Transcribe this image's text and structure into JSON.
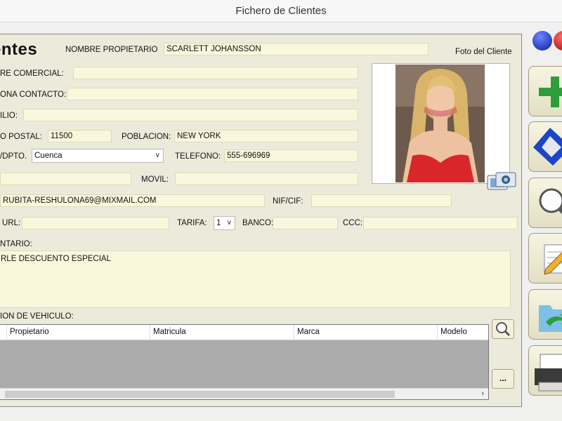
{
  "window": {
    "title": "Fichero de Clientes"
  },
  "form": {
    "heading": "entes",
    "owner_label": "NOMBRE PROPIETARIO",
    "owner_value": "SCARLETT JOHANSSON",
    "photo_label": "Foto del Cliente",
    "commercial_name_label": "RE COMERCIAL:",
    "commercial_name_value": "",
    "contact_label": "ONA CONTACTO:",
    "contact_value": "",
    "address_label": "ILIO:",
    "address_value": "",
    "postal_label": "O POSTAL:",
    "postal_value": "11500",
    "city_label": "POBLACION:",
    "city_value": "NEW YORK",
    "province_label": "/DPTO.",
    "province_value": "Cuenca",
    "phone_label": "TELEFONO:",
    "phone_value": "555-696969",
    "fax_value": "",
    "mobile_label": "MOVIL:",
    "mobile_value": "",
    "email_value": "RUBITA-RESHULONA69@MIXMAIL.COM",
    "nif_label": "NIF/CIF:",
    "nif_value": "",
    "url_label": "URL:",
    "url_value": "",
    "rate_label": "TARIFA:",
    "rate_value": "1",
    "bank_label": "BANCO:",
    "bank_value": "",
    "ccc_label": "CCC:",
    "ccc_value": "",
    "comment_label": "NTARIO:",
    "comment_value": "RLE DESCUENTO ESPECIAL",
    "vehicle_label": "ION DE VEHICULO:"
  },
  "vehicle_table": {
    "columns": [
      "Propietario",
      "Matricula",
      "Marca",
      "Modelo"
    ],
    "more_button": "..."
  },
  "colors": {
    "field_bg": "#f9f7dc",
    "panel_bg": "#ecebdb",
    "accent_green": "#2e9d3a",
    "accent_blue": "#1b46c8"
  }
}
